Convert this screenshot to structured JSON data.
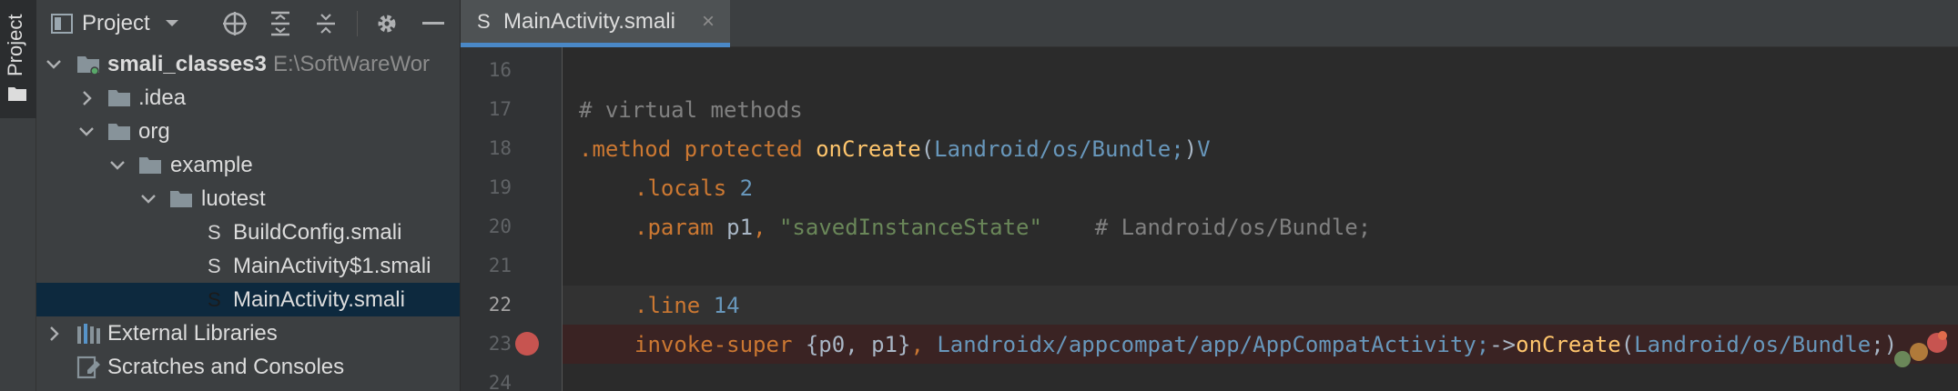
{
  "stripe": {
    "label": "Project"
  },
  "project_panel": {
    "title": "Project",
    "tree": [
      {
        "label": "smali_classes3",
        "path": "E:\\SoftWareWor"
      },
      {
        "label": ".idea"
      },
      {
        "label": "org"
      },
      {
        "label": "example"
      },
      {
        "label": "luotest"
      },
      {
        "label": "BuildConfig.smali"
      },
      {
        "label": "MainActivity$1.smali"
      },
      {
        "label": "MainActivity.smali"
      },
      {
        "label": "External Libraries"
      },
      {
        "label": "Scratches and Consoles"
      }
    ]
  },
  "editor": {
    "tab": {
      "icon_letter": "S",
      "label": "MainActivity.smali",
      "close": "×"
    },
    "line_numbers": [
      "16",
      "17",
      "18",
      "19",
      "20",
      "21",
      "22",
      "23",
      "24"
    ],
    "code": {
      "l17": {
        "comment": "# virtual methods"
      },
      "l18": {
        "dir": ".method",
        "sp1": " ",
        "kw": "protected",
        "sp2": " ",
        "name": "onCreate",
        "p_open": "(",
        "type": "Landroid/os/Bundle;",
        "p_close": ")",
        "ret": "V"
      },
      "l19": {
        "dir": ".locals",
        "sp": " ",
        "num": "2"
      },
      "l20": {
        "dir": ".param",
        "sp": " ",
        "reg": "p1",
        "comma": ",",
        "sp2": " ",
        "str": "\"savedInstanceState\"",
        "gap": "    ",
        "comment": "# Landroid/os/Bundle;"
      },
      "l22": {
        "dir": ".line",
        "sp": " ",
        "num": "14"
      },
      "l23": {
        "op": "invoke-super",
        "sp": " ",
        "regs": "{p0, p1}",
        "comma": ",",
        "sp2": " ",
        "type": "Landroidx/appcompat/app/AppCompatActivity;",
        "arrow": "->",
        "name": "onCreate",
        "p_open": "(",
        "arg": "Landroid/os/Bundle",
        "tail": ";)"
      }
    }
  },
  "colors": {
    "accent": "#4a88c7",
    "breakpoint": "#c75450",
    "keyword": "#cc7832",
    "method": "#ffc66d",
    "string": "#6a8759",
    "number": "#6897bb",
    "comment": "#808080"
  },
  "icons": [
    "folder-icon",
    "chevron-down-icon",
    "crosshair-icon",
    "expand-all-icon",
    "collapse-all-icon",
    "gear-icon",
    "minimize-icon",
    "library-icon",
    "scratches-icon",
    "breakpoint-icon"
  ]
}
